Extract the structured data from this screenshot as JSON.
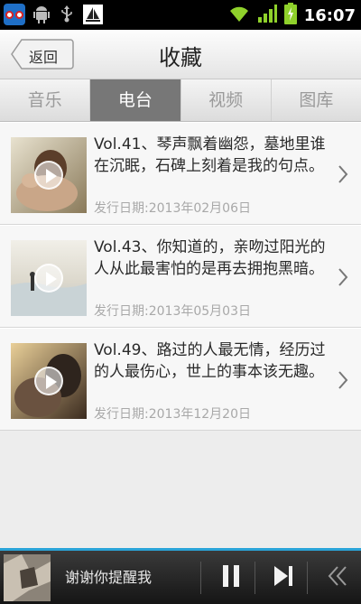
{
  "status_bar": {
    "time": "16:07",
    "icons": [
      "app-icon",
      "android-icon",
      "usb-icon",
      "sailboat-icon",
      "wifi-icon",
      "signal-icon",
      "battery-icon"
    ]
  },
  "header": {
    "back_label": "返回",
    "title": "收藏"
  },
  "tabs": [
    {
      "label": "音乐",
      "active": false
    },
    {
      "label": "电台",
      "active": true
    },
    {
      "label": "视频",
      "active": false
    },
    {
      "label": "图库",
      "active": false
    }
  ],
  "items": [
    {
      "title": "Vol.41、琴声飘着幽怨，墓地里谁在沉眠，石碑上刻着是我的句点。",
      "date": "发行日期:2013年02月06日"
    },
    {
      "title": "Vol.43、你知道的，亲吻过阳光的人从此最害怕的是再去拥抱黑暗。",
      "date": "发行日期:2013年05月03日"
    },
    {
      "title": "Vol.49、路过的人最无情，经历过的人最伤心，世上的事本该无趣。",
      "date": "发行日期:2013年12月20日"
    }
  ],
  "player": {
    "song": "谢谢你提醒我",
    "controls": [
      "pause-icon",
      "next-icon",
      "collapse-icon"
    ]
  },
  "colors": {
    "accent": "#2aa4d8",
    "active_tab": "#777777",
    "status_bar": "#000000"
  }
}
